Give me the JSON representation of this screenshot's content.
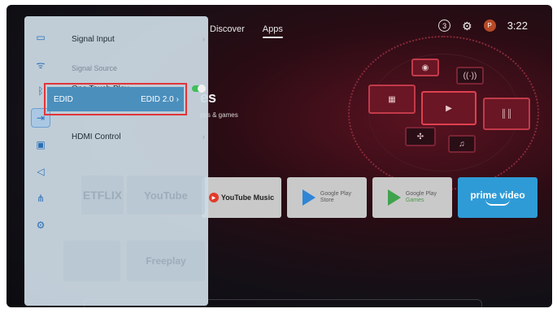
{
  "top_nav": {
    "discover": "Discover",
    "apps": "Apps"
  },
  "status": {
    "notifications_count": "3",
    "profile_initial": "P",
    "time": "3:22"
  },
  "home": {
    "title_fragment": "es",
    "subtitle_fragment": "pps & games"
  },
  "apps_row": {
    "youtube_music": "YouTube Music",
    "google_play_store": {
      "line1": "Google Play",
      "line2": "Store"
    },
    "google_play_games": {
      "line1": "Google Play",
      "line2": "Games"
    },
    "prime_video": "prime video"
  },
  "background_ghosts": {
    "netflix": "ETFLIX",
    "youtube": "YouTube",
    "freeplay": "Freeplay"
  },
  "settings_menu": {
    "signal_input": "Signal Input",
    "signal_source_label": "Signal Source",
    "one_touch_play": "One Touch Play",
    "one_touch_play_on": true,
    "edid": "EDID",
    "edid_value": "EDID 2.0",
    "hdmi_control": "HDMI Control"
  },
  "colors": {
    "selection_outline": "#e0353a",
    "selected_row": "#4b8fbd",
    "toggle_on": "#3fbf5a",
    "accent_red": "#c23a4a"
  }
}
